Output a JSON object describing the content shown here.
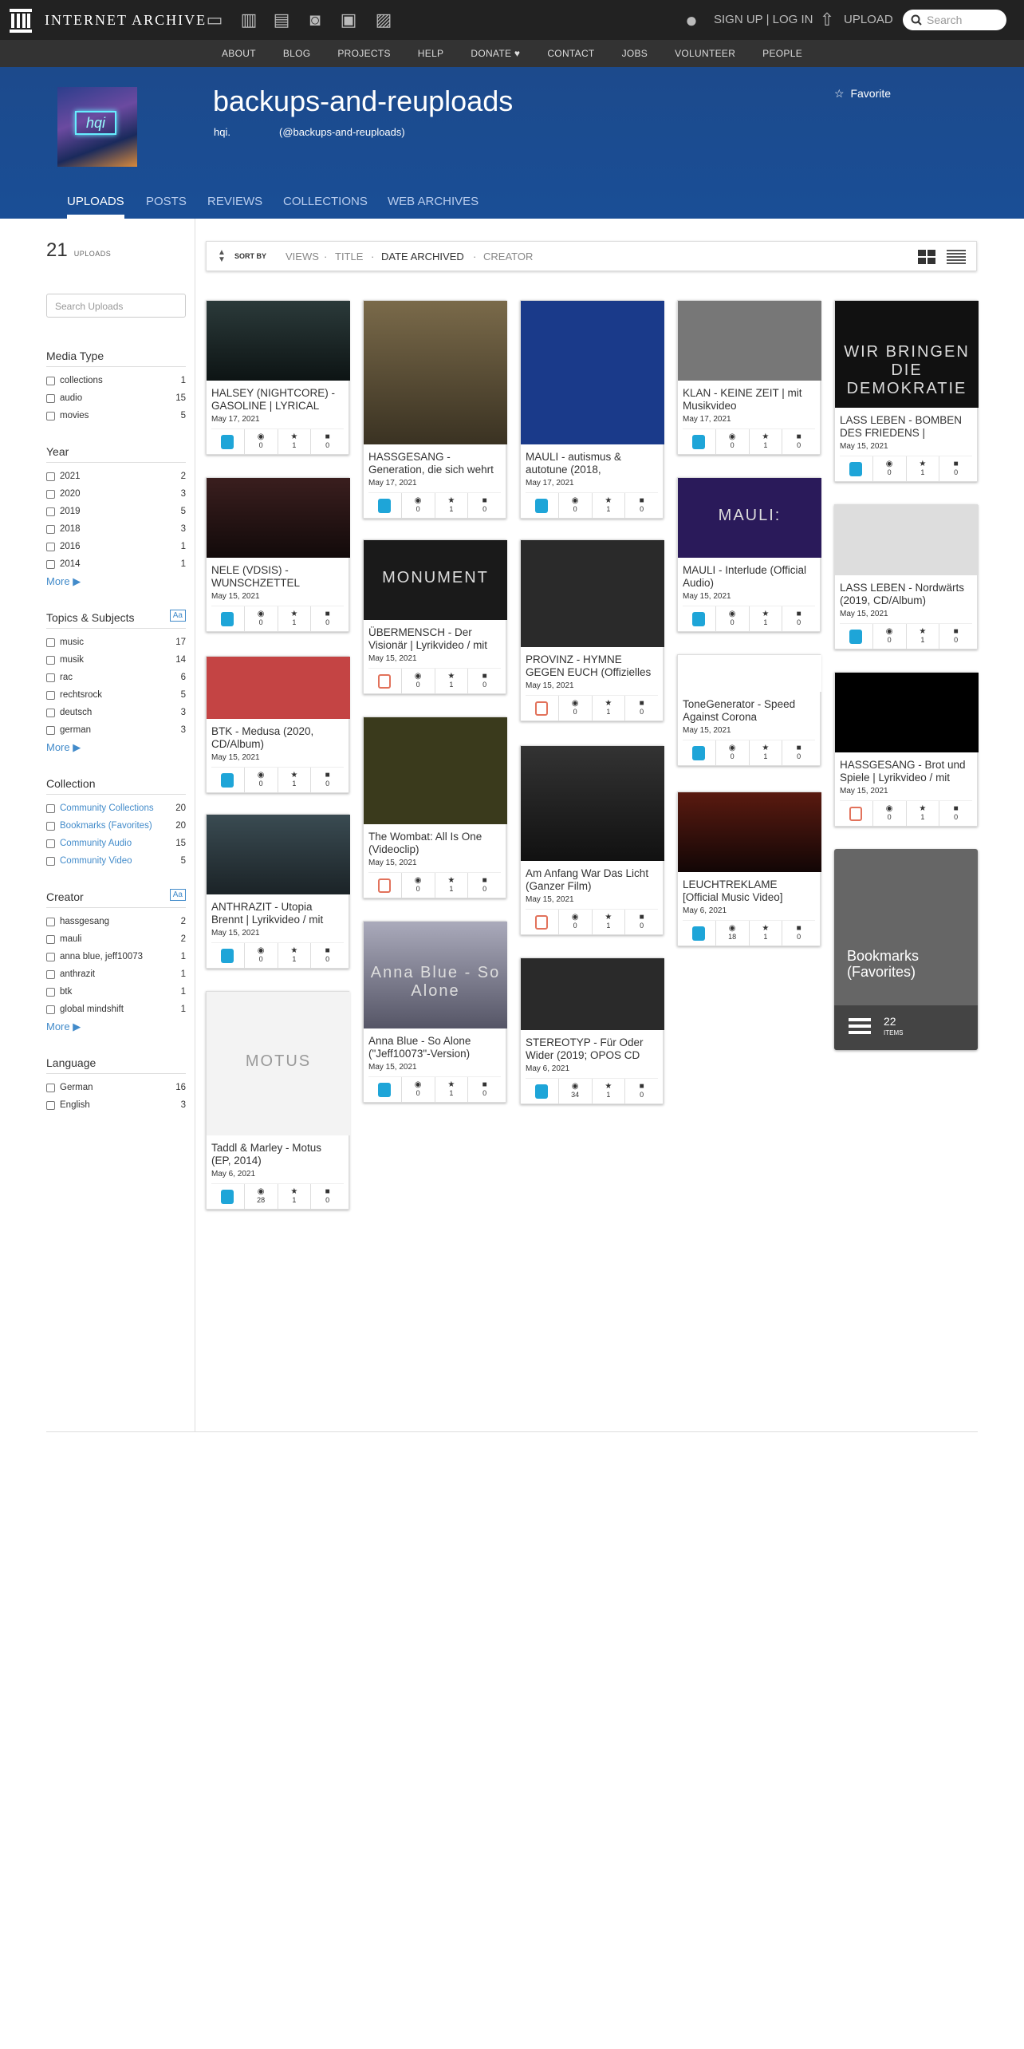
{
  "topnav": {
    "logo": "INTERNET ARCHIVE",
    "signup": "SIGN UP | LOG IN",
    "upload": "UPLOAD",
    "search_placeholder": "Search"
  },
  "subnav": [
    "ABOUT",
    "BLOG",
    "PROJECTS",
    "HELP",
    "DONATE ♥",
    "CONTACT",
    "JOBS",
    "VOLUNTEER",
    "PEOPLE"
  ],
  "profile": {
    "title": "backups-and-reuploads",
    "handle": "hqi.",
    "at": "(@backups-and-reuploads)",
    "favorite": "Favorite",
    "avatar_text": "hqi"
  },
  "tabs": [
    "UPLOADS",
    "POSTS",
    "REVIEWS",
    "COLLECTIONS",
    "WEB ARCHIVES"
  ],
  "uploads": {
    "count": "21",
    "label": "UPLOADS",
    "search_placeholder": "Search Uploads"
  },
  "sort": {
    "label": "SORT BY",
    "options": [
      "VIEWS",
      "TITLE",
      "DATE ARCHIVED",
      "CREATOR"
    ],
    "sep": "·"
  },
  "facets": {
    "media": {
      "title": "Media Type",
      "rows": [
        [
          "collections",
          "1"
        ],
        [
          "audio",
          "15"
        ],
        [
          "movies",
          "5"
        ]
      ]
    },
    "year": {
      "title": "Year",
      "rows": [
        [
          "2021",
          "2"
        ],
        [
          "2020",
          "3"
        ],
        [
          "2019",
          "5"
        ],
        [
          "2018",
          "3"
        ],
        [
          "2016",
          "1"
        ],
        [
          "2014",
          "1"
        ]
      ],
      "more": "More"
    },
    "topics": {
      "title": "Topics & Subjects",
      "rows": [
        [
          "music",
          "17"
        ],
        [
          "musik",
          "14"
        ],
        [
          "rac",
          "6"
        ],
        [
          "rechtsrock",
          "5"
        ],
        [
          "deutsch",
          "3"
        ],
        [
          "german",
          "3"
        ]
      ],
      "more": "More",
      "toggle": "Aa"
    },
    "collection": {
      "title": "Collection",
      "rows": [
        [
          "Community Collections",
          "20"
        ],
        [
          "Bookmarks (Favorites)",
          "20"
        ],
        [
          "Community Audio",
          "15"
        ],
        [
          "Community Video",
          "5"
        ]
      ]
    },
    "creator": {
      "title": "Creator",
      "rows": [
        [
          "hassgesang",
          "2"
        ],
        [
          "mauli",
          "2"
        ],
        [
          "anna blue, jeff10073",
          "1"
        ],
        [
          "anthrazit",
          "1"
        ],
        [
          "btk",
          "1"
        ],
        [
          "global mindshift",
          "1"
        ]
      ],
      "more": "More",
      "toggle": "Aa"
    },
    "language": {
      "title": "Language",
      "rows": [
        [
          "German",
          "16"
        ],
        [
          "English",
          "3"
        ]
      ]
    }
  },
  "items": [
    {
      "title": "HALSEY (NIGHTCORE) - GASOLINE | LYRICAL",
      "date": "May 17, 2021",
      "type": "audio",
      "v": "0",
      "f": "1",
      "r": "0"
    },
    {
      "title": "NELE (VDSIS) - WUNSCHZETTEL",
      "date": "May 15, 2021",
      "type": "audio",
      "v": "0",
      "f": "1",
      "r": "0"
    },
    {
      "title": "BTK - Medusa (2020, CD/Album)",
      "date": "May 15, 2021",
      "type": "audio",
      "v": "0",
      "f": "1",
      "r": "0"
    },
    {
      "title": "ANTHRAZIT - Utopia Brennt | Lyrikvideo / mit",
      "date": "May 15, 2021",
      "type": "audio",
      "v": "0",
      "f": "1",
      "r": "0"
    },
    {
      "title": "Taddl & Marley - Motus (EP, 2014)",
      "date": "May 6, 2021",
      "type": "audio",
      "v": "28",
      "f": "1",
      "r": "0",
      "thumb_text": "MOTUS"
    },
    {
      "title": "HASSGESANG - Generation, die sich wehrt",
      "date": "May 17, 2021",
      "type": "audio",
      "v": "0",
      "f": "1",
      "r": "0"
    },
    {
      "title": "ÜBERMENSCH - Der Visionär | Lyrikvideo / mit",
      "date": "May 15, 2021",
      "type": "movie",
      "v": "0",
      "f": "1",
      "r": "0",
      "thumb_text": "MONUMENT"
    },
    {
      "title": "The Wombat: All Is One (Videoclip)",
      "date": "May 15, 2021",
      "type": "movie",
      "v": "0",
      "f": "1",
      "r": "0"
    },
    {
      "title": "Anna Blue - So Alone (\"Jeff10073\"-Version)",
      "date": "May 15, 2021",
      "type": "audio",
      "v": "0",
      "f": "1",
      "r": "0",
      "thumb_text": "Anna Blue - So Alone"
    },
    {
      "title": "MAULI - autismus & autotune (2018,",
      "date": "May 17, 2021",
      "type": "audio",
      "v": "0",
      "f": "1",
      "r": "0"
    },
    {
      "title": "PROVINZ - HYMNE GEGEN EUCH (Offizielles",
      "date": "May 15, 2021",
      "type": "movie",
      "v": "0",
      "f": "1",
      "r": "0"
    },
    {
      "title": "Am Anfang War Das Licht (Ganzer Film)",
      "date": "May 15, 2021",
      "type": "movie",
      "v": "0",
      "f": "1",
      "r": "0"
    },
    {
      "title": "STEREOTYP - Für Oder Wider (2019; OPOS CD",
      "date": "May 6, 2021",
      "type": "audio",
      "v": "34",
      "f": "1",
      "r": "0"
    },
    {
      "title": "KLAN - KEINE ZEIT | mit Musikvideo",
      "date": "May 17, 2021",
      "type": "audio",
      "v": "0",
      "f": "1",
      "r": "0"
    },
    {
      "title": "MAULI - Interlude (Official Audio)",
      "date": "May 15, 2021",
      "type": "audio",
      "v": "0",
      "f": "1",
      "r": "0",
      "thumb_text": "MAULI:"
    },
    {
      "title": "ToneGenerator - Speed Against Corona",
      "date": "May 15, 2021",
      "type": "audio",
      "v": "0",
      "f": "1",
      "r": "0"
    },
    {
      "title": "LEUCHTREKLAME [Official Music Video]",
      "date": "May 6, 2021",
      "type": "audio",
      "v": "18",
      "f": "1",
      "r": "0"
    },
    {
      "title": "LASS LEBEN - BOMBEN DES FRIEDENS |",
      "date": "May 15, 2021",
      "type": "audio",
      "v": "0",
      "f": "1",
      "r": "0",
      "thumb_text": "WIR BRINGEN DIE DEMOKRATIE"
    },
    {
      "title": "LASS LEBEN - Nordwärts (2019, CD/Album)",
      "date": "May 15, 2021",
      "type": "audio",
      "v": "0",
      "f": "1",
      "r": "0"
    },
    {
      "title": "HASSGESANG - Brot und Spiele | Lyrikvideo / mit",
      "date": "May 15, 2021",
      "type": "movie",
      "v": "0",
      "f": "1",
      "r": "0"
    }
  ],
  "collection_tile": {
    "title": "Bookmarks (Favorites)",
    "count": "22",
    "count_label": "ITEMS"
  },
  "colors": {
    "hero": "#1a4e96",
    "audio": "#1ea5d8",
    "movie": "#e2725b",
    "link": "#428bca"
  }
}
